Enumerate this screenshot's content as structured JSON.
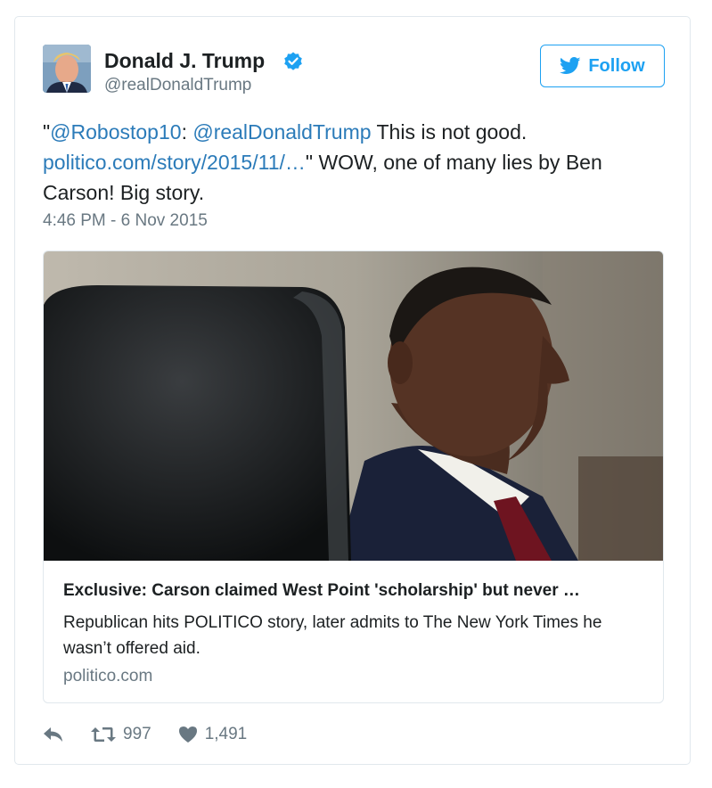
{
  "author": {
    "name": "Donald J. Trump",
    "handle": "@realDonaldTrump",
    "verified": true
  },
  "follow_button": {
    "label": "Follow",
    "icon": "twitter-bird-icon"
  },
  "tweet": {
    "quote_open": "\"",
    "mention1": "@Robostop10",
    "colon": ": ",
    "mention2": "@realDonaldTrump",
    "text1": " This is not good.",
    "link": "politico.com/story/2015/11/…",
    "text2": "\" WOW, one of many lies by Ben Carson! Big story.",
    "timestamp": "4:46 PM - 6 Nov 2015"
  },
  "card": {
    "title": "Exclusive: Carson claimed West Point 'scholarship' but never …",
    "description": "Republican hits POLITICO story, later admits to The New York Times he wasn’t offered aid.",
    "domain": "politico.com"
  },
  "actions": {
    "reply_icon": "reply-icon",
    "retweet_icon": "retweet-icon",
    "retweet_count": "997",
    "like_icon": "heart-icon",
    "like_count": "1,491"
  },
  "colors": {
    "accent": "#1da1f2",
    "link": "#2b7bb9",
    "muted": "#697882",
    "border": "#e1e8ed"
  }
}
